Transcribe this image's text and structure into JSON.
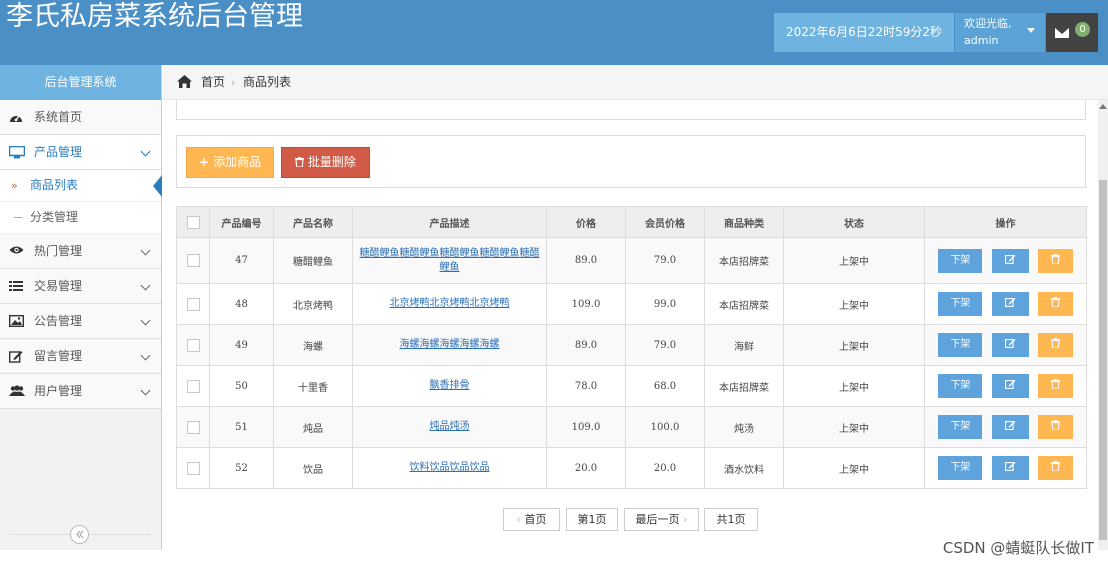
{
  "header": {
    "title": "李氏私房菜系统后台管理",
    "datetime": "2022年6月6日22时59分2秒",
    "welcome": "欢迎光临,",
    "username": "admin",
    "mail_count": "0"
  },
  "sidebar": {
    "heading": "后台管理系统",
    "items": [
      {
        "label": "系统首页"
      },
      {
        "label": "产品管理"
      },
      {
        "label": "热门管理"
      },
      {
        "label": "交易管理"
      },
      {
        "label": "公告管理"
      },
      {
        "label": "留言管理"
      },
      {
        "label": "用户管理"
      }
    ],
    "subitems": [
      {
        "label": "商品列表"
      },
      {
        "label": "分类管理"
      }
    ]
  },
  "breadcrumb": {
    "home": "首页",
    "current": "商品列表"
  },
  "toolbar": {
    "add_label": "添加商品",
    "delete_label": "批量删除"
  },
  "table": {
    "headers": [
      "产品编号",
      "产品名称",
      "产品描述",
      "价格",
      "会员价格",
      "商品种类",
      "状态",
      "操作"
    ],
    "rows": [
      {
        "id": "47",
        "name": "糖醋鲤鱼",
        "desc": "糖醋鲤鱼糖醋鲤鱼糖醋鲤鱼糖醋鲤鱼糖醋鲤鱼",
        "price": "89.0",
        "member_price": "79.0",
        "category": "本店招牌菜",
        "status": "上架中",
        "action": "下架"
      },
      {
        "id": "48",
        "name": "北京烤鸭",
        "desc": "北京烤鸭北京烤鸭北京烤鸭",
        "price": "109.0",
        "member_price": "99.0",
        "category": "本店招牌菜",
        "status": "上架中",
        "action": "下架"
      },
      {
        "id": "49",
        "name": "海螺",
        "desc": "海螺海螺海螺海螺海螺",
        "price": "89.0",
        "member_price": "79.0",
        "category": "海鲜",
        "status": "上架中",
        "action": "下架"
      },
      {
        "id": "50",
        "name": "十里香",
        "desc": "飘香排骨",
        "price": "78.0",
        "member_price": "68.0",
        "category": "本店招牌菜",
        "status": "上架中",
        "action": "下架"
      },
      {
        "id": "51",
        "name": "炖品",
        "desc": "炖品炖汤",
        "price": "109.0",
        "member_price": "100.0",
        "category": "炖汤",
        "status": "上架中",
        "action": "下架"
      },
      {
        "id": "52",
        "name": "饮品",
        "desc": "饮料饮品饮品饮品",
        "price": "20.0",
        "member_price": "20.0",
        "category": "酒水饮料",
        "status": "上架中",
        "action": "下架"
      }
    ]
  },
  "pagination": {
    "first": "首页",
    "page1": "第1页",
    "last": "最后一页",
    "total": "共1页"
  },
  "watermark": "CSDN @蜻蜓队长做IT",
  "icons": {
    "envelope": "envelope-icon",
    "home": "home-icon"
  }
}
